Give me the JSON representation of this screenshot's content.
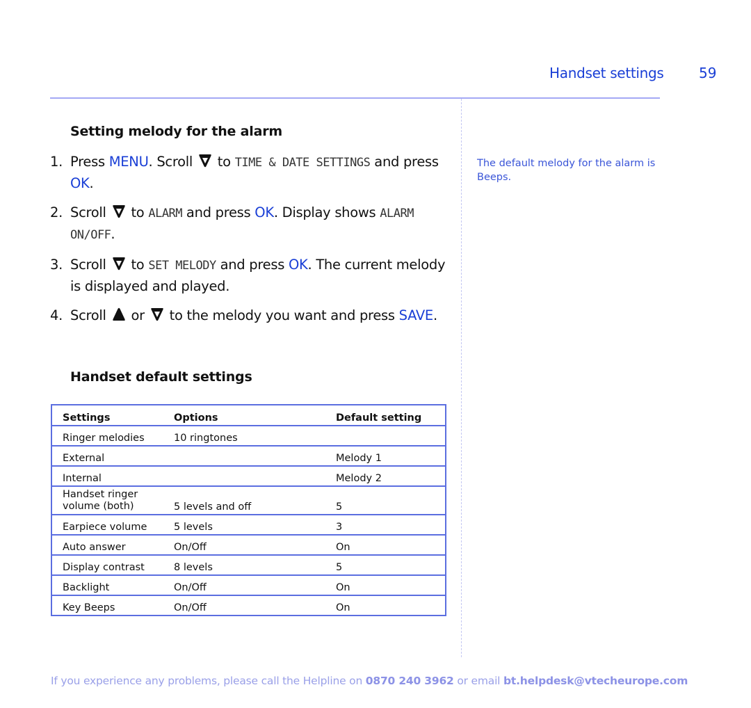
{
  "header": {
    "section_title": "Handset settings",
    "page_number": "59"
  },
  "section1": {
    "heading": "Setting melody for the alarm",
    "steps": [
      {
        "num": "1.",
        "parts": {
          "a": "Press ",
          "menu": "MENU",
          "b": ". Scroll ",
          "c": " to ",
          "lcd": "TIME & DATE SETTINGS",
          "d": " and press ",
          "ok": "OK",
          "e": "."
        }
      },
      {
        "num": "2.",
        "parts": {
          "a": "Scroll ",
          "b": " to ",
          "lcd1": "ALARM",
          "c": " and press ",
          "ok": "OK",
          "d": ". Display shows ",
          "lcd2": "ALARM ON/OFF",
          "e": "."
        }
      },
      {
        "num": "3.",
        "parts": {
          "a": "Scroll ",
          "b": " to ",
          "lcd": "SET MELODY",
          "c": " and press ",
          "ok": "OK",
          "d": ". The current melody is displayed and played."
        }
      },
      {
        "num": "4.",
        "parts": {
          "a": "Scroll ",
          "or": " or ",
          "b": " to the melody you want and press ",
          "save": "SAVE",
          "c": "."
        }
      }
    ]
  },
  "side_note": "The default melody for the alarm is Beeps.",
  "section2": {
    "heading": "Handset default settings",
    "table": {
      "headers": [
        "Settings",
        "Options",
        "Default setting"
      ],
      "rows": [
        [
          "Ringer melodies",
          "10 ringtones",
          ""
        ],
        [
          "External",
          "",
          "Melody 1"
        ],
        [
          "Internal",
          "",
          "Melody 2"
        ],
        [
          "Handset ringer volume (both)",
          "5 levels and off",
          "5"
        ],
        [
          "Earpiece volume",
          "5 levels",
          "3"
        ],
        [
          "Auto answer",
          "On/Off",
          "On"
        ],
        [
          "Display contrast",
          "8 levels",
          "5"
        ],
        [
          "Backlight",
          "On/Off",
          "On"
        ],
        [
          "Key Beeps",
          "On/Off",
          "On"
        ]
      ]
    }
  },
  "footer": {
    "prefix": "If you experience any problems, please call the Helpline on ",
    "phone": "0870 240 3962",
    "middle": " or email ",
    "email": "bt.helpdesk@vtecheurope.com"
  },
  "icons": {
    "scroll_down": "scroll-down-icon",
    "scroll_up": "scroll-up-icon"
  },
  "colors": {
    "accent": "#1a3fd6",
    "rule": "#a3a8f5",
    "table_border": "#5b6ee0",
    "footer": "#9aa0e8"
  }
}
